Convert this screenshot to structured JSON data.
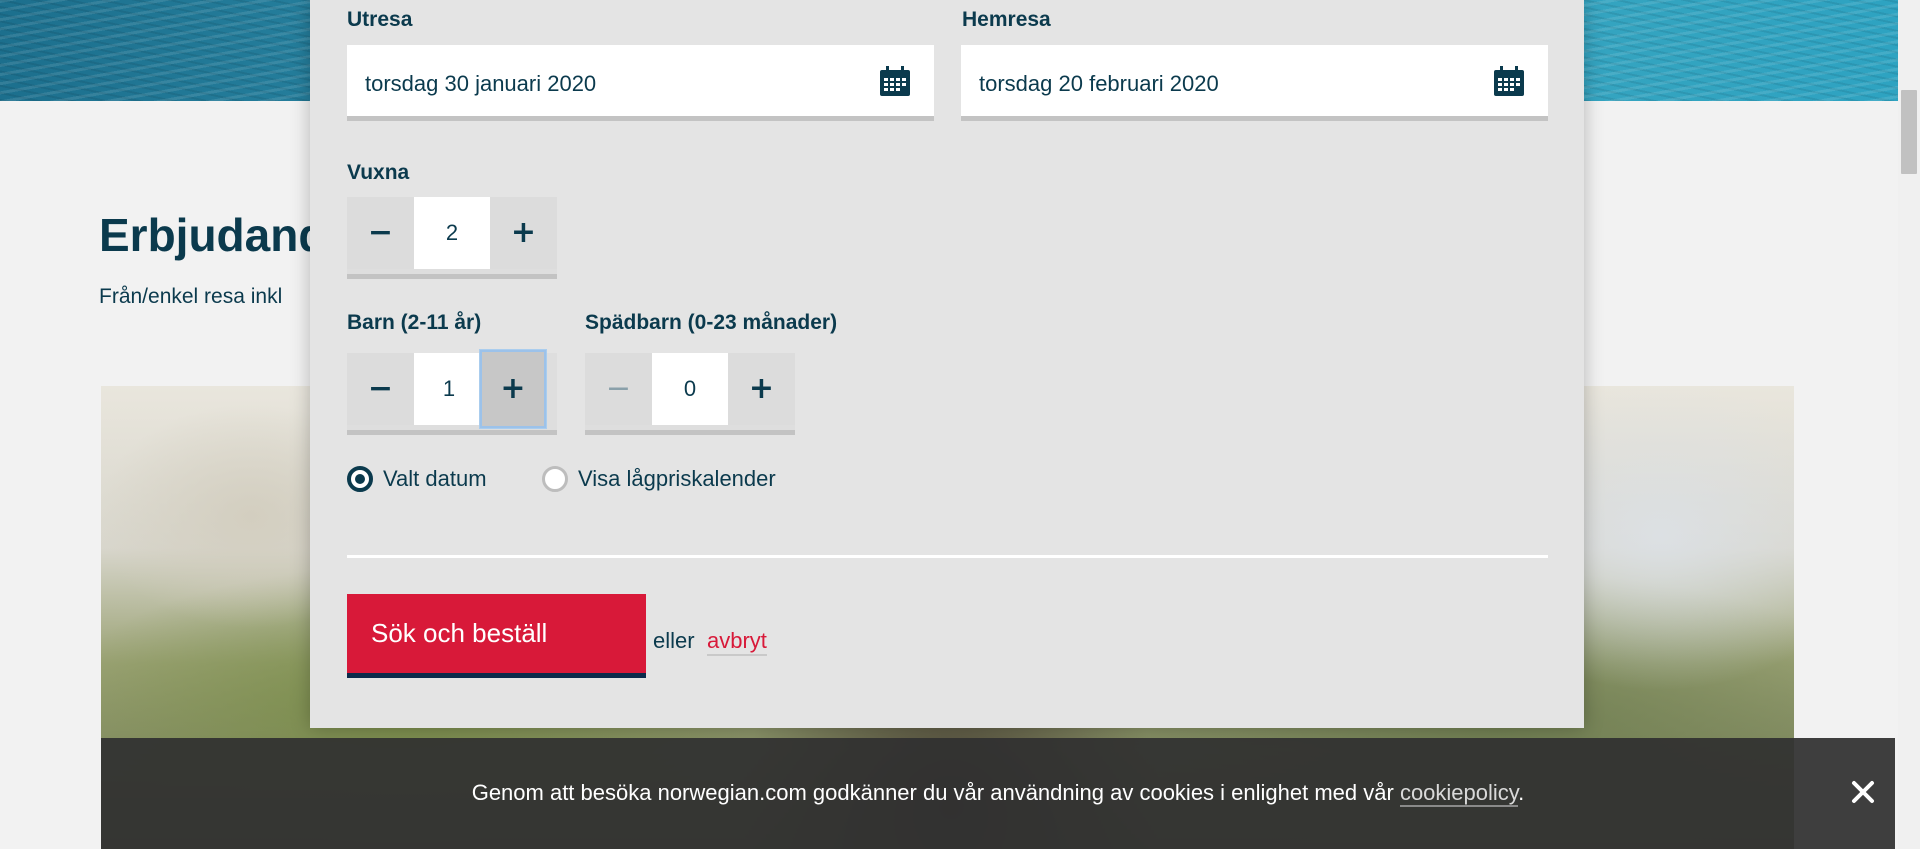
{
  "page": {
    "offers_heading": "Erbjudand",
    "offers_subtitle": "Från/enkel resa inkl"
  },
  "booking": {
    "outbound": {
      "label": "Utresa",
      "value": "torsdag 30 januari 2020",
      "icon": "calendar-icon"
    },
    "return": {
      "label": "Hemresa",
      "value": "torsdag 20 februari 2020",
      "icon": "calendar-icon"
    },
    "adults": {
      "label": "Vuxna",
      "value": "2",
      "minus": "−",
      "plus": "+"
    },
    "children": {
      "label": "Barn (2-11 år)",
      "value": "1",
      "minus": "−",
      "plus": "+"
    },
    "infants": {
      "label": "Spädbarn (0-23 månader)",
      "value": "0",
      "minus": "−",
      "plus": "+"
    },
    "date_options": [
      {
        "label": "Valt datum",
        "selected": true
      },
      {
        "label": "Visa lågpriskalender",
        "selected": false
      }
    ],
    "search_button": "Sök och beställ",
    "or_text": "eller",
    "cancel_link": "avbryt"
  },
  "cookie_banner": {
    "text": "Genom att besöka norwegian.com godkänner du vår användning av cookies i enlighet med vår ",
    "link": "cookiepolicy",
    "suffix": ".",
    "close_icon": "close-icon"
  },
  "colors": {
    "brand_dark": "#0b3a4d",
    "brand_red": "#d81939",
    "panel_bg": "#e4e4e4"
  }
}
